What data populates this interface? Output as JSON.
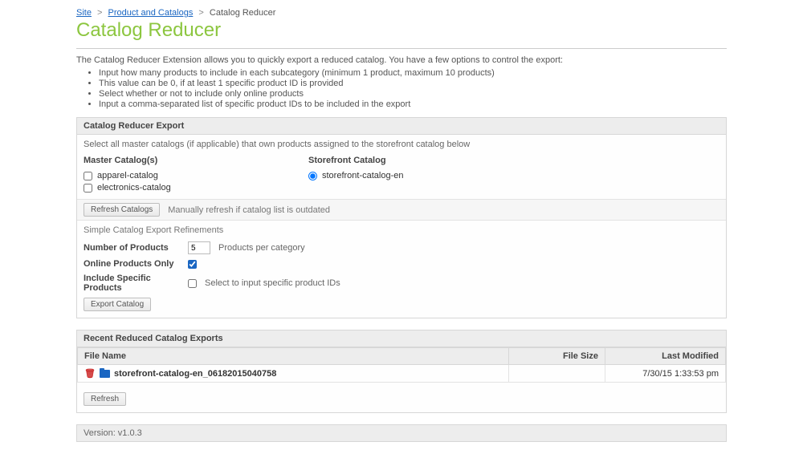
{
  "breadcrumb": {
    "site": "Site",
    "products": "Product and Catalogs",
    "current": "Catalog Reducer"
  },
  "title": "Catalog Reducer",
  "intro": {
    "para": "The Catalog Reducer Extension allows you to quickly export a reduced catalog. You have a few options to control the export:",
    "bullets": [
      "Input how many products to include in each subcategory (minimum 1 product, maximum 10 products)",
      "This value can be 0, if at least 1 specific product ID is provided",
      "Select whether or not to include only online products",
      "Input a comma-separated list of specific product IDs to be included in the export"
    ]
  },
  "export": {
    "heading": "Catalog Reducer Export",
    "hint": "Select all master catalogs (if applicable) that own products assigned to the storefront catalog below",
    "master_label": "Master Catalog(s)",
    "master_items": [
      "apparel-catalog",
      "electronics-catalog"
    ],
    "storefront_label": "Storefront Catalog",
    "storefront_items": [
      "storefront-catalog-en"
    ],
    "refresh_btn": "Refresh Catalogs",
    "refresh_hint": "Manually refresh if catalog list is outdated",
    "refine_subhead": "Simple Catalog Export Refinements",
    "rows": {
      "num_products_label": "Number of Products",
      "num_products_value": "5",
      "num_products_after": "Products per category",
      "online_only_label": "Online Products Only",
      "include_specific_label": "Include Specific Products",
      "include_specific_after": "Select to input specific product IDs"
    },
    "export_btn": "Export Catalog"
  },
  "recent": {
    "heading": "Recent Reduced Catalog Exports",
    "col_filename": "File Name",
    "col_filesize": "File Size",
    "col_modified": "Last Modified",
    "rows": [
      {
        "name": "storefront-catalog-en_06182015040758",
        "size": "",
        "modified": "7/30/15 1:33:53 pm"
      }
    ],
    "refresh_btn": "Refresh"
  },
  "version_label": "Version: v1.0.3"
}
